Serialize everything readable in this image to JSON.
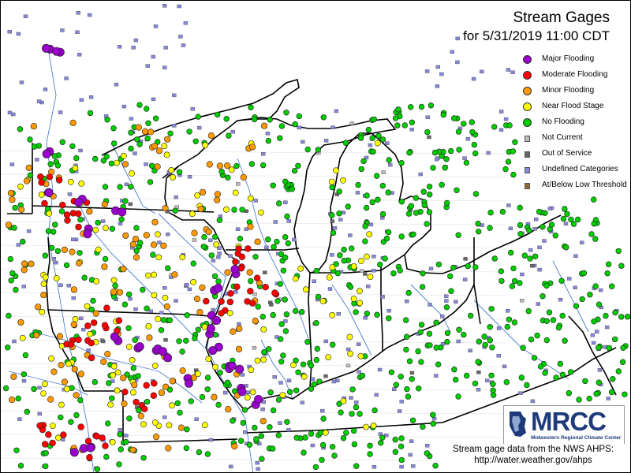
{
  "map": {
    "title": "Stream Gages",
    "subtitle": "for 5/31/2019 11:00 CDT",
    "source_line1": "Stream gage data from the NWS AHPS:",
    "source_line2": "http://water.weather.gov/ahps",
    "logo_text": "MRCC",
    "logo_subtext": "Midwestern Regional Climate Center",
    "legend": [
      {
        "label": "Major Flooding",
        "color": "#9900cc",
        "shape": "circle"
      },
      {
        "label": "Moderate Flooding",
        "color": "#ff0000",
        "shape": "circle"
      },
      {
        "label": "Minor Flooding",
        "color": "#ff9900",
        "shape": "circle"
      },
      {
        "label": "Near Flood Stage",
        "color": "#ffff00",
        "shape": "circle"
      },
      {
        "label": "No Flooding",
        "color": "#00cc00",
        "shape": "circle"
      },
      {
        "label": "Not Current",
        "color": "#bcbcbc",
        "shape": "square"
      },
      {
        "label": "Out of Service",
        "color": "#666666",
        "shape": "square"
      },
      {
        "label": "Undefined Categories",
        "color": "#8888dd",
        "shape": "square"
      },
      {
        "label": "At/Below Low Threshold",
        "color": "#996633",
        "shape": "square"
      }
    ],
    "colors": {
      "water_lines": "#4f7fd0",
      "state_borders": "#000000",
      "county_lines": "#dddddd",
      "border": "#000000"
    }
  }
}
